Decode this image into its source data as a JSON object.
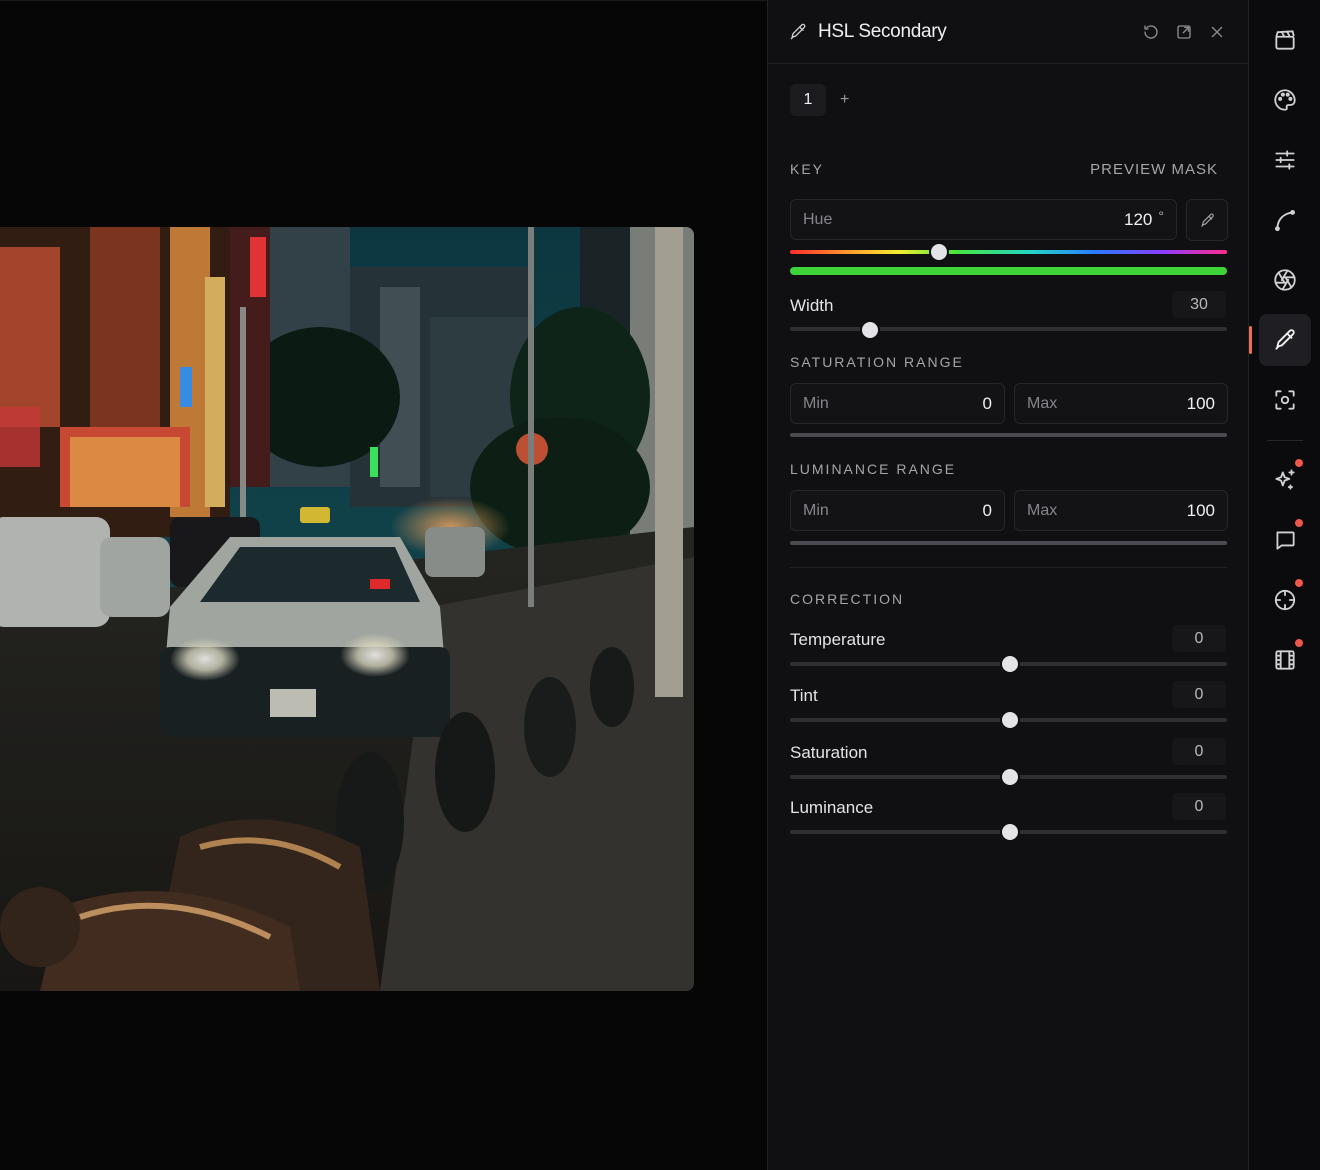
{
  "panel": {
    "title": "HSL Secondary",
    "tabs": [
      "1"
    ],
    "add_tab": "+",
    "key": {
      "label": "KEY",
      "preview_mask": "PREVIEW MASK",
      "hue": {
        "label": "Hue",
        "value": "120",
        "unit": "°"
      },
      "width": {
        "label": "Width",
        "value": "30"
      }
    },
    "saturation_range": {
      "label": "SATURATION RANGE",
      "min_label": "Min",
      "min_value": "0",
      "max_label": "Max",
      "max_value": "100"
    },
    "luminance_range": {
      "label": "LUMINANCE RANGE",
      "min_label": "Min",
      "min_value": "0",
      "max_label": "Max",
      "max_value": "100"
    },
    "correction": {
      "label": "CORRECTION",
      "sliders": [
        {
          "label": "Temperature",
          "value": "0"
        },
        {
          "label": "Tint",
          "value": "0"
        },
        {
          "label": "Saturation",
          "value": "0"
        },
        {
          "label": "Luminance",
          "value": "0"
        }
      ]
    }
  },
  "toolbar": {
    "tools": [
      {
        "name": "clapperboard-icon",
        "active": false,
        "badge": false
      },
      {
        "name": "palette-icon",
        "active": false,
        "badge": false
      },
      {
        "name": "sliders-icon",
        "active": false,
        "badge": false
      },
      {
        "name": "curve-icon",
        "active": false,
        "badge": false
      },
      {
        "name": "aperture-icon",
        "active": false,
        "badge": false
      },
      {
        "name": "eyedropper-icon",
        "active": true,
        "badge": false
      },
      {
        "name": "focus-icon",
        "active": false,
        "badge": false
      },
      {
        "name": "sparkle-icon",
        "active": false,
        "badge": true
      },
      {
        "name": "comment-icon",
        "active": false,
        "badge": true
      },
      {
        "name": "crosshair-icon",
        "active": false,
        "badge": true
      },
      {
        "name": "film-icon",
        "active": false,
        "badge": true
      }
    ]
  },
  "colors": {
    "accent": "#f06a55",
    "badge": "#f0574a",
    "panel_bg": "#101012",
    "key_bar": "#3fd33a"
  }
}
